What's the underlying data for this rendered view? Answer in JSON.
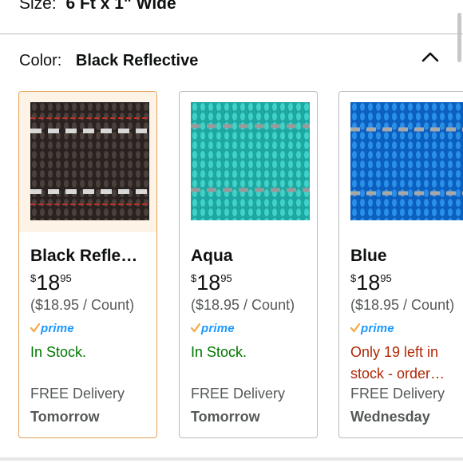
{
  "size": {
    "label": "Size:",
    "value": "6 Ft x 1\" Wide"
  },
  "color": {
    "label": "Color:",
    "value": "Black Reflective",
    "toggle_icon": "chevron-up-icon"
  },
  "options": [
    {
      "name": "Black Refle…",
      "swatch": "black",
      "price": {
        "symbol": "$",
        "whole": "18",
        "fraction": "95"
      },
      "unit_price": "($18.95 / Count)",
      "prime": "prime",
      "stock": "In Stock.",
      "stock_line2": "",
      "delivery": "FREE Delivery",
      "delivery_day": "Tomorrow",
      "selected": true
    },
    {
      "name": "Aqua",
      "swatch": "aqua",
      "price": {
        "symbol": "$",
        "whole": "18",
        "fraction": "95"
      },
      "unit_price": "($18.95 / Count)",
      "prime": "prime",
      "stock": "In Stock.",
      "stock_line2": "",
      "delivery": "FREE Delivery",
      "delivery_day": "Tomorrow",
      "selected": false
    },
    {
      "name": "Blue",
      "swatch": "blue",
      "price": {
        "symbol": "$",
        "whole": "18",
        "fraction": "95"
      },
      "unit_price": "($18.95 / Count)",
      "prime": "prime",
      "stock": "Only 19 left in",
      "stock_line2": "stock - order…",
      "delivery": "FREE Delivery",
      "delivery_day": "Wednesday",
      "selected": false
    }
  ],
  "colors": {
    "selected_border": "#e3a25a",
    "in_stock": "#007600",
    "low_stock": "#b12704",
    "prime_blue": "#1a98ff",
    "prime_check": "#f3a847"
  }
}
